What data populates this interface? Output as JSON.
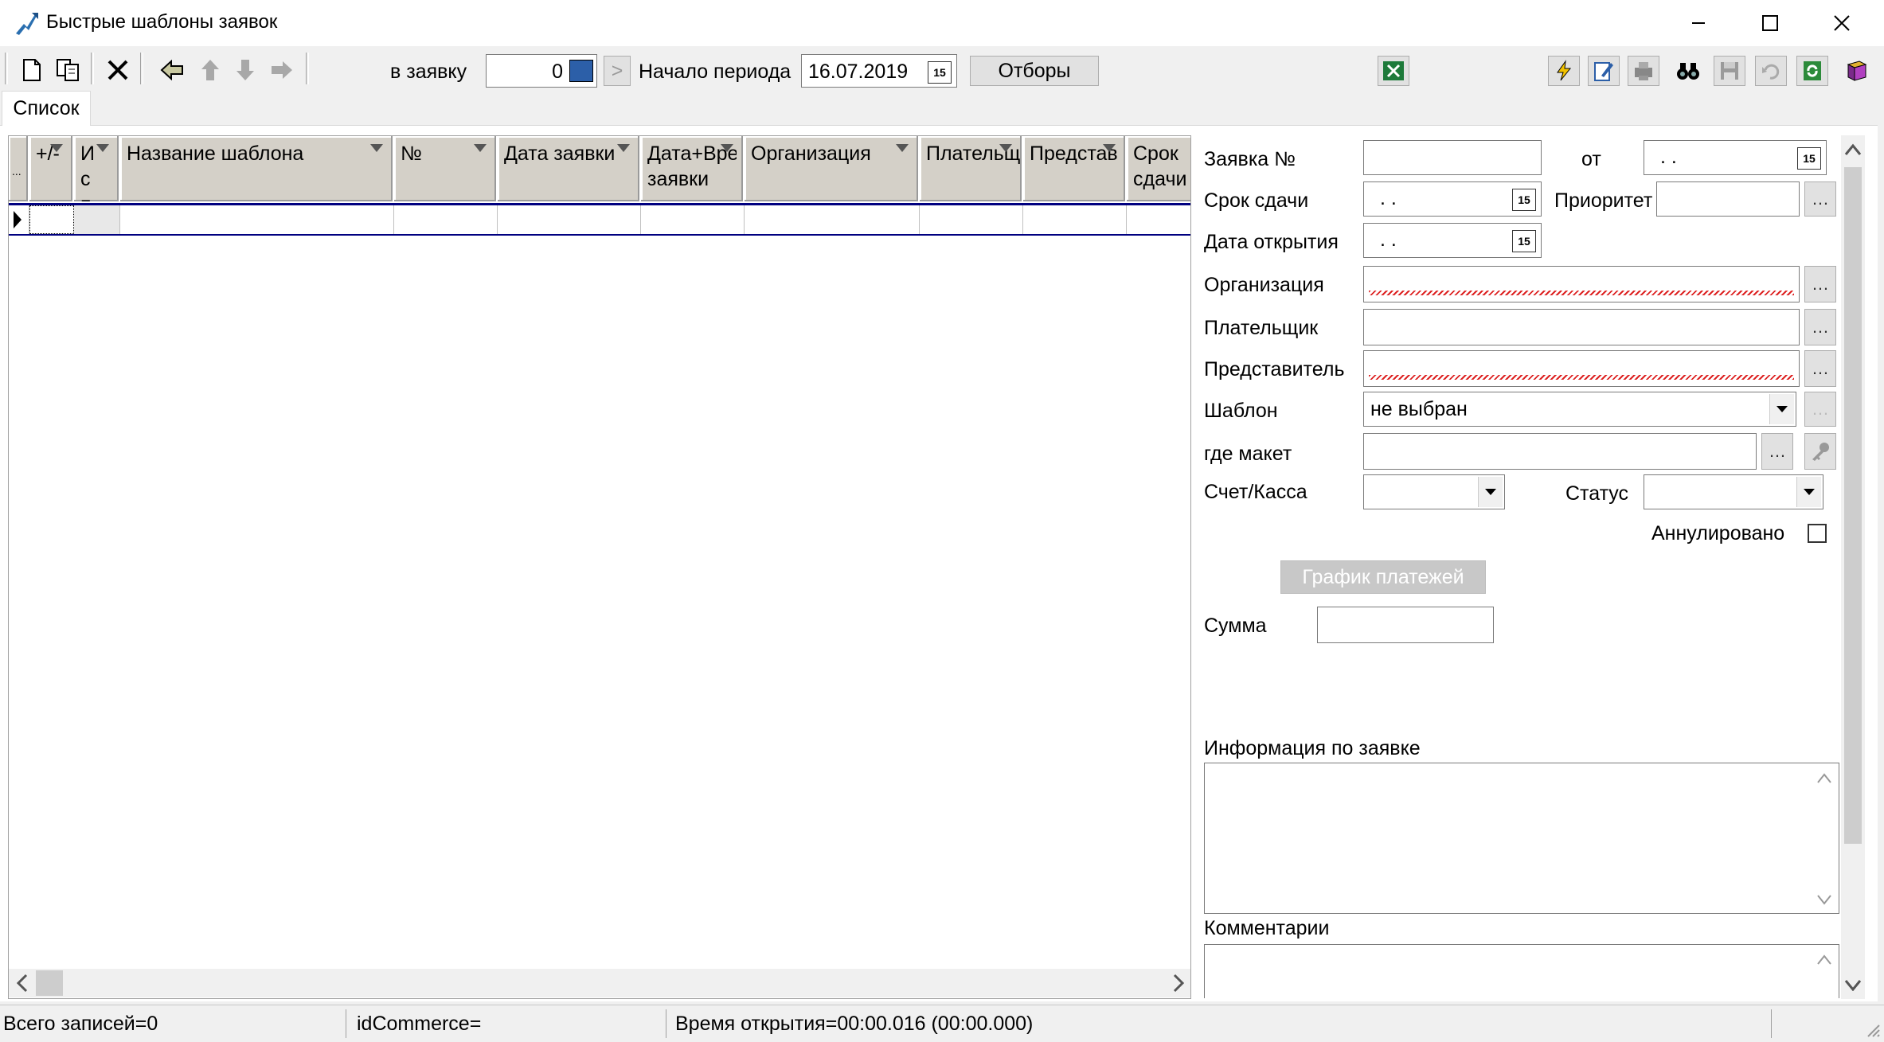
{
  "window": {
    "title": "Быстрые шаблоны заявок"
  },
  "toolbar": {
    "to_request_label": "в заявку",
    "to_request_value": "0",
    "next_label": ">",
    "period_start_label": "Начало периода",
    "period_start_value": "16.07.2019",
    "filters_button": "Отборы"
  },
  "tabs": [
    {
      "label": "Список"
    }
  ],
  "grid": {
    "columns": [
      {
        "label": "..."
      },
      {
        "label": "+/-"
      },
      {
        "label": "Исп в"
      },
      {
        "label": "Название шаблона"
      },
      {
        "label": "№"
      },
      {
        "label": "Дата заявки"
      },
      {
        "label": "Дата+Время заявки"
      },
      {
        "label": "Организация"
      },
      {
        "label": "Плательщ"
      },
      {
        "label": "Представ"
      },
      {
        "label": "Срок сдачи"
      }
    ]
  },
  "form": {
    "request_no_label": "Заявка №",
    "request_no_value": "",
    "from_label": "от",
    "from_value": " .  .",
    "due_label": "Срок сдачи",
    "due_value": " .  .",
    "priority_label": "Приоритет",
    "priority_value": "",
    "open_date_label": "Дата открытия",
    "open_date_value": " .  .",
    "organization_label": "Организация",
    "payer_label": "Плательщик",
    "representative_label": "Представитель",
    "template_label": "Шаблон",
    "template_value": "не выбран",
    "layout_label": "где макет",
    "account_label": "Счет/Касса",
    "status_label": "Статус",
    "cancelled_label": "Аннулировано",
    "cancelled_checked": false,
    "payment_schedule_button": "График платежей",
    "sum_label": "Сумма",
    "sum_value": "",
    "info_label": "Информация по заявке",
    "comments_label": "Комментарии"
  },
  "statusbar": {
    "records": "Всего записей=0",
    "id_commerce": "idCommerce=",
    "open_time": "Время открытия=00:00.016 (00:00.000)"
  },
  "colors": {
    "grid_header": "#d4d0c8",
    "grid_rule": "#000080",
    "error_underline": "#dd2222",
    "excel_green": "#1d7a3a"
  }
}
